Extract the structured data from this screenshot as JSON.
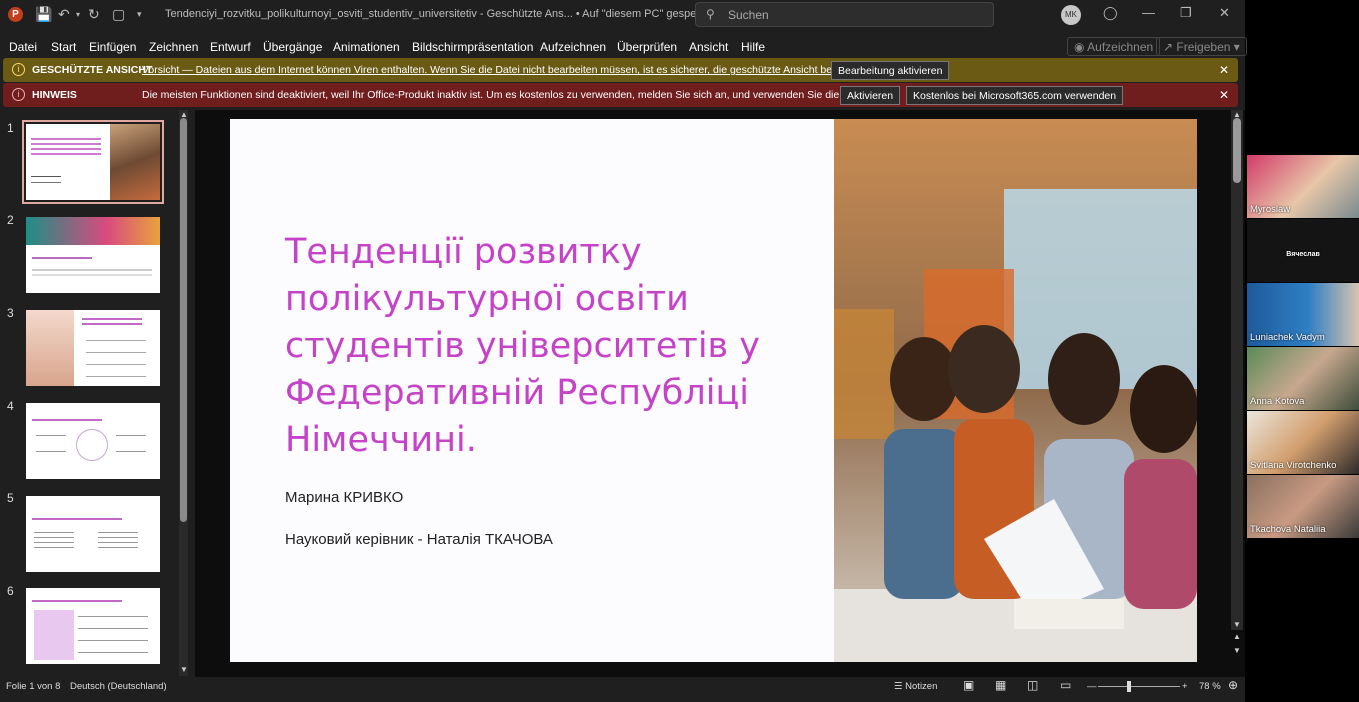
{
  "titlebar": {
    "app_icon": "P",
    "doc_title": "Tendenciyi_rozvitku_polikulturnoyi_osviti_studentiv_universitetiv  -  Geschützte Ans...  •  Auf \"diesem PC\" gespeichert",
    "search_placeholder": "Suchen",
    "user_initials": "MK",
    "icons": [
      "save-icon",
      "undo-icon",
      "redo-icon",
      "present-icon",
      "customize-icon",
      "search-icon",
      "lightbulb-icon",
      "minimize-icon",
      "maximize-icon",
      "close-icon"
    ]
  },
  "menu": {
    "items": [
      "Datei",
      "Start",
      "Einfügen",
      "Zeichnen",
      "Entwurf",
      "Übergänge",
      "Animationen",
      "Bildschirmpräsentation",
      "Aufzeichnen",
      "Überprüfen",
      "Ansicht",
      "Hilfe"
    ],
    "record_label": "Aufzeichnen",
    "share_label": "Freigeben"
  },
  "protected_view": {
    "label": "GESCHÜTZTE ANSICHT",
    "text": "Vorsicht — Dateien aus dem Internet können Viren enthalten. Wenn Sie die Datei nicht bearbeiten müssen, ist es sicherer, die geschützte Ansicht beizubehalten.",
    "button": "Bearbeitung aktivieren",
    "color": "#6b5a14"
  },
  "notice": {
    "label": "HINWEIS",
    "text": "Die meisten Funktionen sind deaktiviert, weil Ihr Office-Produkt inaktiv ist. Um es kostenlos zu verwenden, melden Sie sich an, und verwenden Sie die Webversion.",
    "button_activate": "Aktivieren",
    "button_web": "Kostenlos bei Microsoft365.com verwenden",
    "color": "#6f1d1d"
  },
  "thumbnails": [
    {
      "num": "1",
      "selected": true
    },
    {
      "num": "2",
      "selected": false
    },
    {
      "num": "3",
      "selected": false
    },
    {
      "num": "4",
      "selected": false
    },
    {
      "num": "5",
      "selected": false
    },
    {
      "num": "6",
      "selected": false
    }
  ],
  "slide": {
    "title": "Тенденції розвитку полікультурної освіти студентів університетів у Федеративній Республіці Німеччині.",
    "author": "Марина КРИВКО",
    "advisor": "Науковий керівник - Наталія ТКАЧОВА",
    "title_color": "#c543c9"
  },
  "statusbar": {
    "slide_info": "Folie 1 von 8",
    "language": "Deutsch (Deutschland)",
    "notes": "Notizen",
    "zoom": "78 %",
    "zoom_fraction": 0.36
  },
  "participants": [
    {
      "name": "Myroslaw"
    },
    {
      "name": "Вячеслав"
    },
    {
      "name": "Luniachek Vadym"
    },
    {
      "name": "Anna Kotova"
    },
    {
      "name": "Svitlana Virotchenko"
    },
    {
      "name": "Tkachova Nataliia"
    }
  ]
}
